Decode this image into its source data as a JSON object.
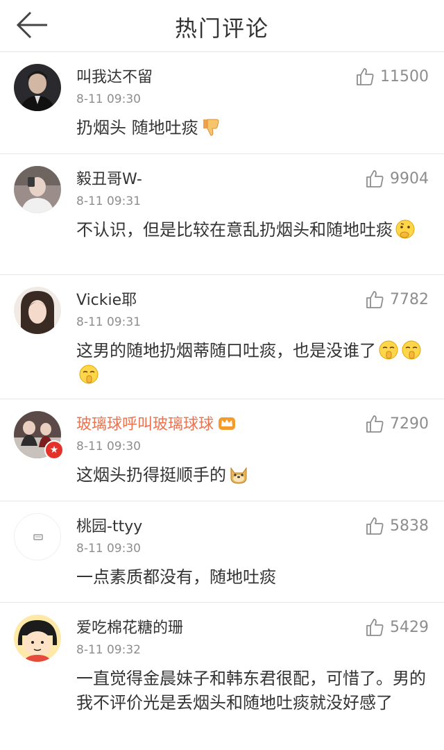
{
  "header": {
    "title": "热门评论",
    "back_icon": "back-arrow-icon"
  },
  "comments": [
    {
      "username": "叫我达不留",
      "time": "8-11 09:30",
      "likes": "11500",
      "text": "扔烟头 随地吐痰",
      "emojis": [
        "thumbs-down-emoji"
      ]
    },
    {
      "username": "毅丑哥W-",
      "time": "8-11 09:31",
      "likes": "9904",
      "text": "不认识，但是比较在意乱扔烟头和随地吐痰",
      "emojis": [
        "thinking-emoji"
      ]
    },
    {
      "username": "Vickie耶",
      "time": "8-11 09:31",
      "likes": "7782",
      "text": "这男的随地扔烟蒂随口吐痰，也是没谁了",
      "emojis": [
        "shush-emoji",
        "shush-emoji",
        "shush-emoji"
      ]
    },
    {
      "username": "玻璃球呼叫玻璃球球",
      "time": "8-11 09:30",
      "likes": "7290",
      "text": "这烟头扔得挺顺手的",
      "emojis": [
        "doge-emoji"
      ],
      "vip_color": "#eb7350"
    },
    {
      "username": "桃园-ttyy",
      "time": "8-11 09:30",
      "likes": "5838",
      "text": "一点素质都没有，随地吐痰",
      "emojis": []
    },
    {
      "username": "爱吃棉花糖的珊",
      "time": "8-11 09:32",
      "likes": "5429",
      "text": "一直觉得金晨妹子和韩东君很配，可惜了。男的我不评价光是丢烟头和随地吐痰就没好感了",
      "emojis": []
    }
  ]
}
